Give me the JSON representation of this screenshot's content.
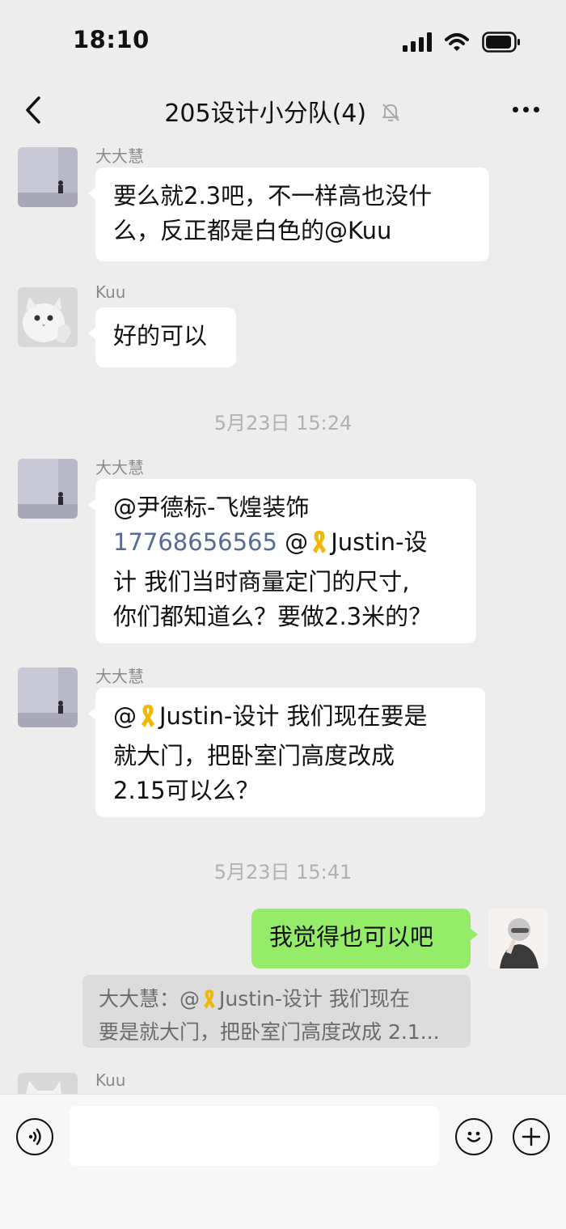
{
  "status": {
    "time": "18:10"
  },
  "header": {
    "title": "205设计小分队(4)"
  },
  "messages": {
    "m1": {
      "sender": "大大慧",
      "lines": [
        "要么就2.3吧，不一样高也没什",
        "么，反正都是白色的@Kuu"
      ]
    },
    "m2": {
      "sender": "Kuu",
      "text": "好的可以"
    },
    "stamp1": "5月23日 15:24",
    "m3": {
      "sender": "大大慧",
      "l1": "@尹德标-飞煌装饰",
      "phone": "17768656565",
      "l2_rest": " @",
      "l2_name": "Justin-设",
      "l3": "计 我们当时商量定门的尺寸,",
      "l4": "你们都知道么？要做2.3米的？"
    },
    "m4": {
      "sender": "大大慧",
      "l1_pre": "@",
      "l1_rest": "Justin-设计 我们现在要是",
      "l2": "就大门，把卧室门高度改成",
      "l3": "2.15可以么？"
    },
    "stamp2": "5月23日 15:41",
    "m5": {
      "text": "我觉得也可以吧"
    },
    "quote": {
      "l1_pre": "大大慧：@",
      "l1_rest": "Justin-设计 我们现在",
      "l2": "要是就大门，把卧室门高度改成 2.1..."
    },
    "m6": {
      "sender": "Kuu"
    }
  },
  "icons": {
    "back": "chevron-left-icon",
    "mute": "bell-mute-icon",
    "more": "more-icon",
    "voice": "voice-icon",
    "emoji": "emoji-icon",
    "plus": "plus-icon",
    "ribbon": "yellow-ribbon-icon"
  },
  "colors": {
    "background": "#ededed",
    "bubble_in": "#ffffff",
    "bubble_out": "#95ec69",
    "link": "#576b95",
    "timestamp": "#b0b0b0"
  }
}
